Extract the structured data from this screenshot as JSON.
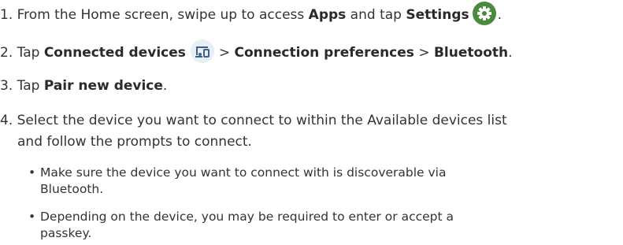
{
  "steps": [
    {
      "number": "1.",
      "pre": "From the Home screen, swipe up to access ",
      "bold1": "Apps",
      "mid": " and tap ",
      "bold2": "Settings",
      "icon": "settings-gear-icon",
      "post": "."
    },
    {
      "number": "2.",
      "pre": "Tap ",
      "bold1": "Connected devices",
      "icon": "connected-devices-icon",
      "sep1": ">",
      "bold2": "Connection preferences",
      "sep2": ">",
      "bold3": "Bluetooth",
      "post": "."
    },
    {
      "number": "3.",
      "pre": "Tap ",
      "bold1": "Pair new device",
      "post": "."
    },
    {
      "number": "4.",
      "line1": "Select the device you want to connect to within the Available devices list",
      "line2": "and follow the prompts to connect."
    }
  ],
  "bullets": [
    {
      "marker": "•",
      "line1": "Make sure the device you want to connect with is discoverable via",
      "line2": "Bluetooth."
    },
    {
      "marker": "•",
      "line1": "Depending on the device, you may be required to enter or accept a",
      "line2": "passkey."
    }
  ],
  "colors": {
    "text": "#333333",
    "settings_icon_bg": "#4c8b3e",
    "devices_icon_bg": "#e8eef6",
    "devices_icon_fg": "#3d5f8a"
  }
}
